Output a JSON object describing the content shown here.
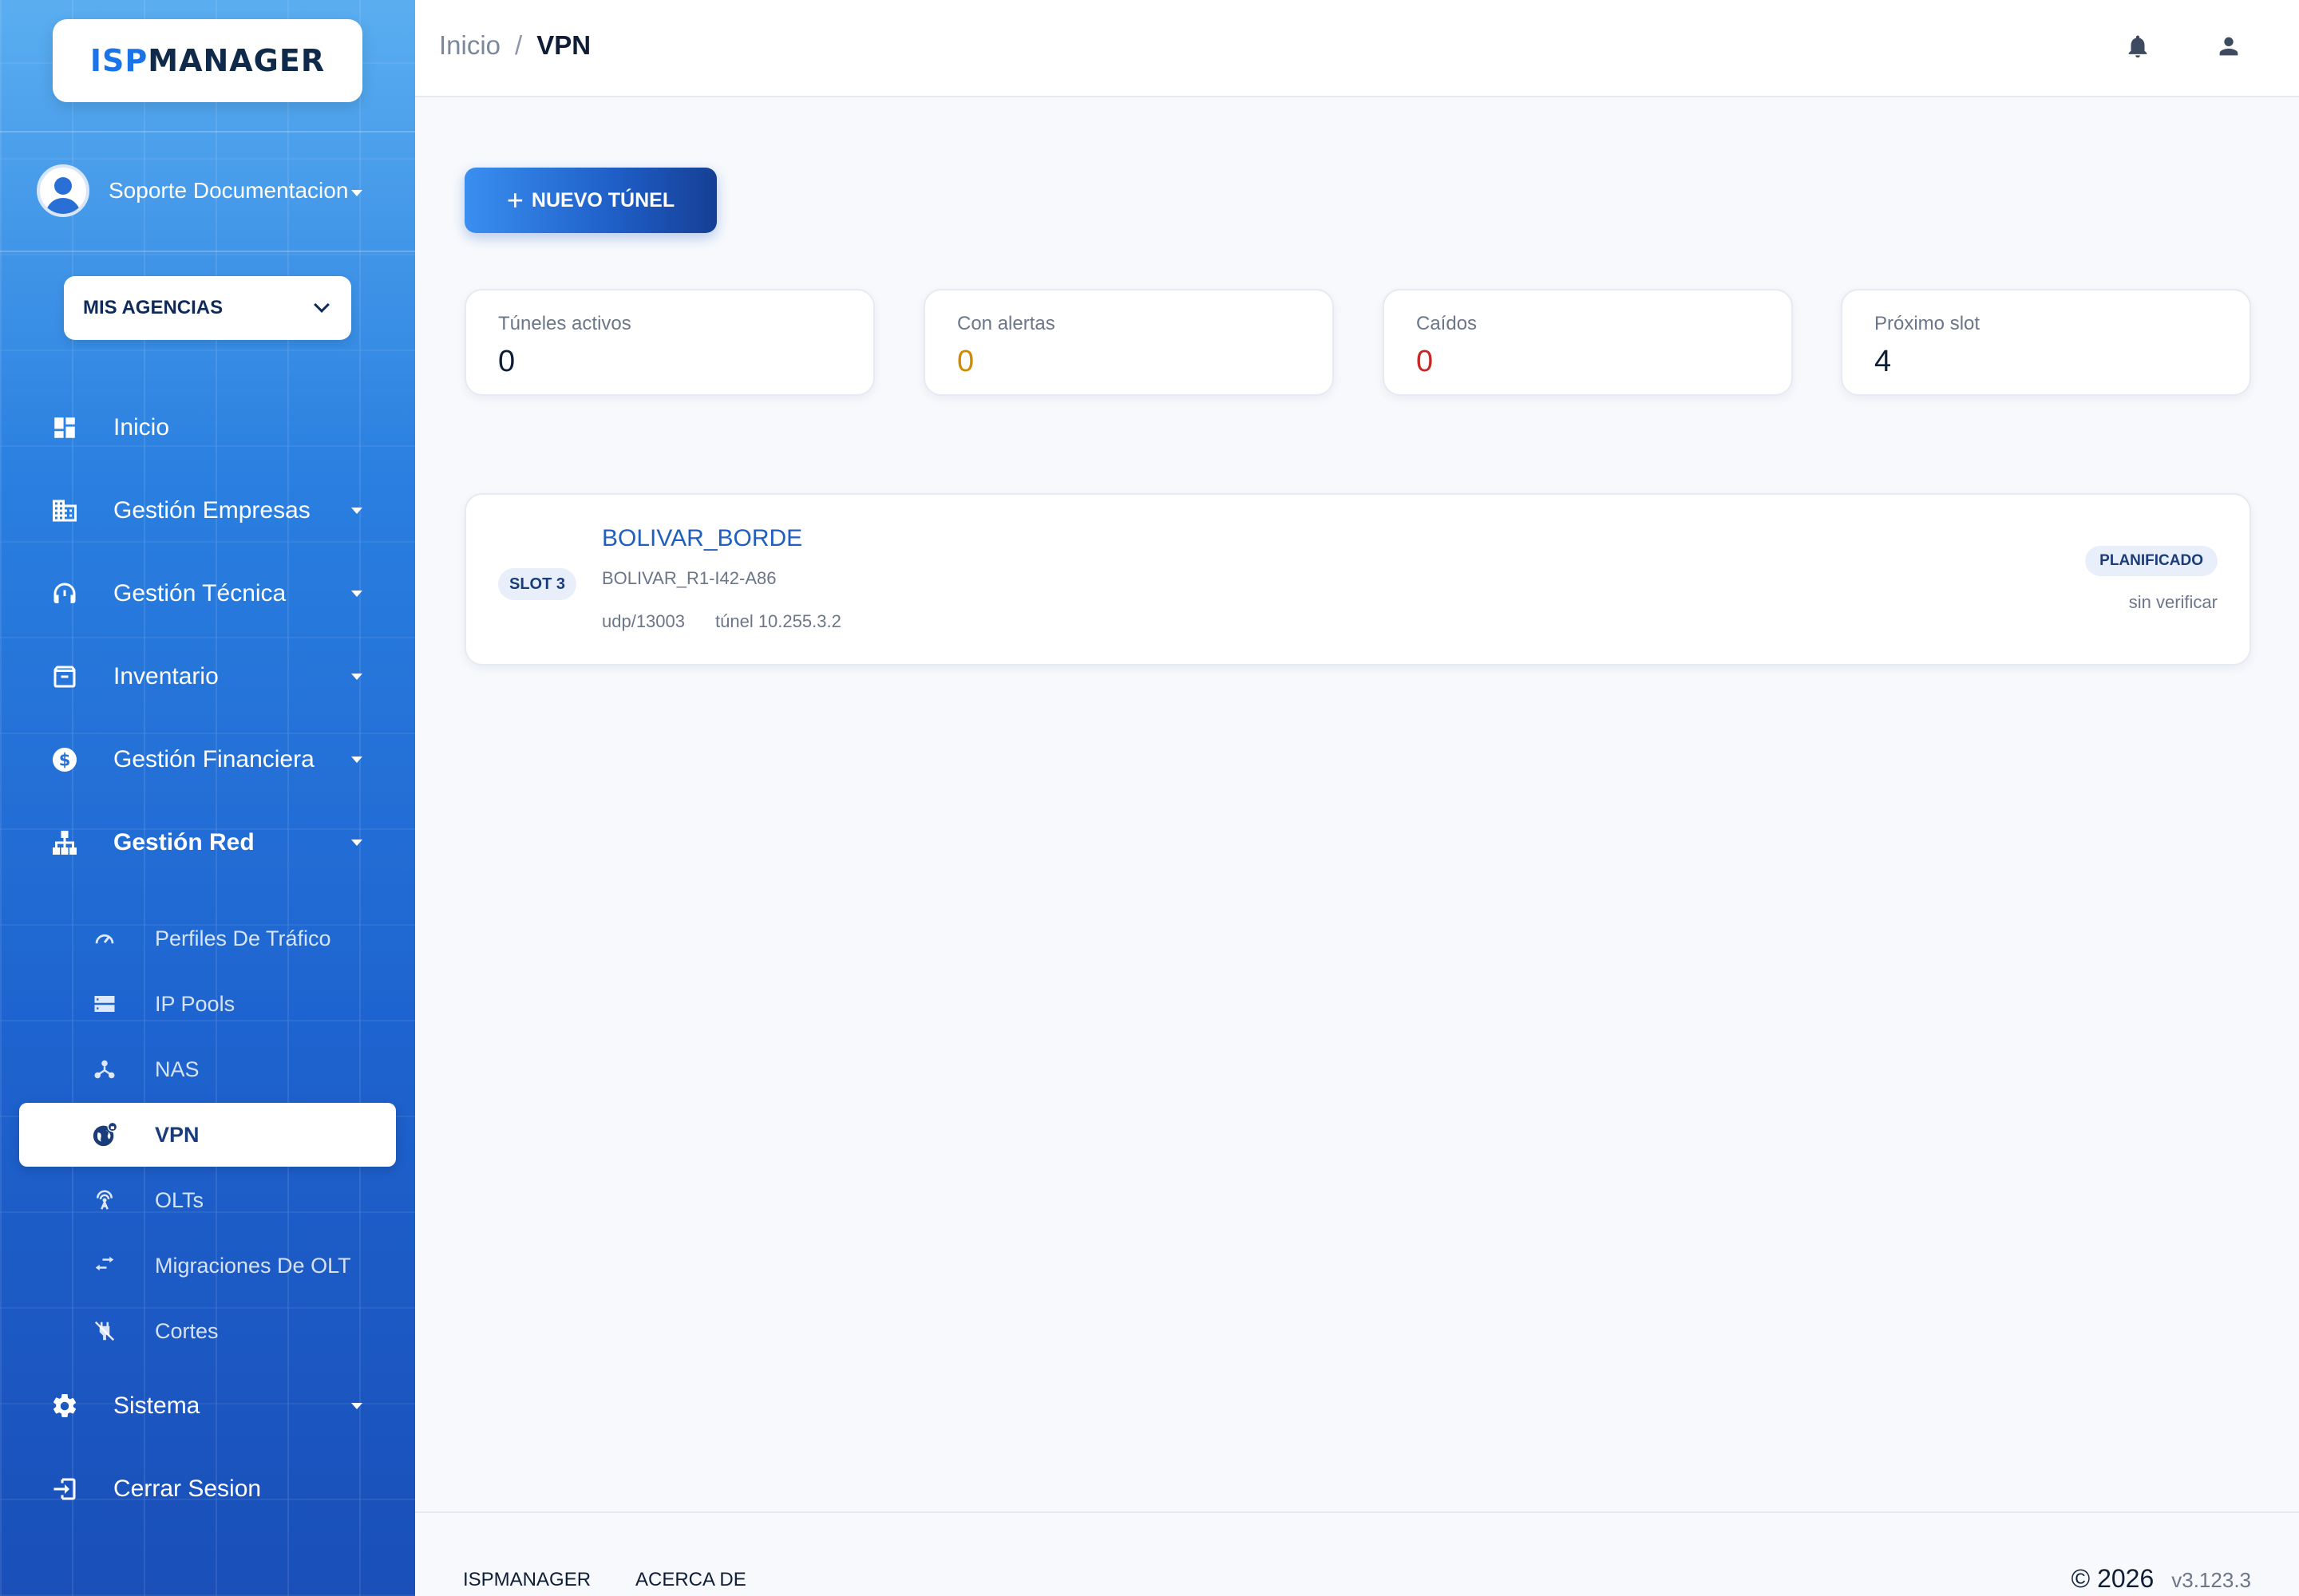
{
  "brand": {
    "part1": "ISP",
    "part2": "MANAGER"
  },
  "user": {
    "name": "Soporte Documentacion"
  },
  "agency_select": {
    "label": "MIS AGENCIAS"
  },
  "nav": {
    "inicio": "Inicio",
    "empresas": "Gestión Empresas",
    "tecnica": "Gestión Técnica",
    "inventario": "Inventario",
    "financiera": "Gestión Financiera",
    "red": "Gestión Red",
    "sistema": "Sistema",
    "logout": "Cerrar Sesion"
  },
  "subnav": {
    "perfiles": "Perfiles De Tráfico",
    "pools": "IP Pools",
    "nas": "NAS",
    "vpn": "VPN",
    "olts": "OLTs",
    "migraciones": "Migraciones De OLT",
    "cortes": "Cortes"
  },
  "breadcrumb": {
    "home": "Inicio",
    "separator": "/",
    "current": "VPN"
  },
  "actions": {
    "new_tunnel_plus": "+",
    "new_tunnel": "NUEVO TÚNEL"
  },
  "stats": [
    {
      "label": "Túneles activos",
      "value": "0"
    },
    {
      "label": "Con alertas",
      "value": "0"
    },
    {
      "label": "Caídos",
      "value": "0"
    },
    {
      "label": "Próximo slot",
      "value": "4"
    }
  ],
  "tunnel": {
    "slot": "SLOT 3",
    "name": "BOLIVAR_BORDE",
    "id": "BOLIVAR_R1-I42-A86",
    "port": "udp/13003",
    "tunnel_ip": "túnel 10.255.3.2",
    "status": "PLANIFICADO",
    "verification": "sin verificar"
  },
  "footer": {
    "brand_link": "ISPMANAGER",
    "about_link": "ACERCA DE",
    "copyright": "© 2026",
    "version": "v3.123.3"
  },
  "colors": {
    "accent": "#1e5ec6",
    "warning": "#d08a00",
    "danger": "#c62828"
  }
}
